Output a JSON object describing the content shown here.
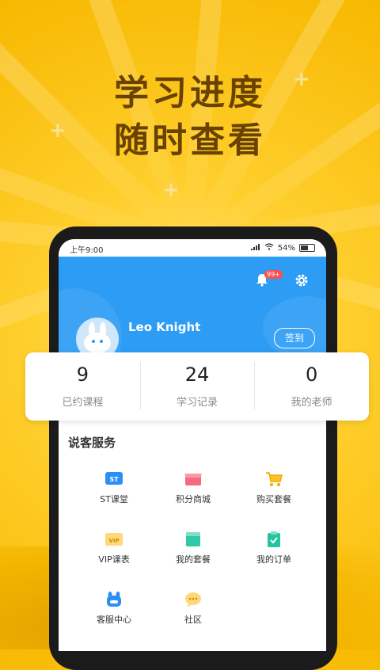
{
  "promo": {
    "headline_line1": "学习进度",
    "headline_line2": "随时查看"
  },
  "status_bar": {
    "time": "上午9:00",
    "battery": "54%"
  },
  "profile": {
    "notifications_badge": "99+",
    "username": "Leo Knight",
    "checkin_label": "签到"
  },
  "stats": [
    {
      "value": "9",
      "label": "已约课程"
    },
    {
      "value": "24",
      "label": "学习记录"
    },
    {
      "value": "0",
      "label": "我的老师"
    }
  ],
  "services": {
    "title": "说客服务",
    "items": [
      {
        "label": "ST课堂",
        "icon": "st-classroom-icon"
      },
      {
        "label": "积分商城",
        "icon": "points-mall-icon"
      },
      {
        "label": "购买套餐",
        "icon": "shopping-cart-icon"
      },
      {
        "label": "VIP课表",
        "icon": "vip-schedule-icon"
      },
      {
        "label": "我的套餐",
        "icon": "my-package-icon"
      },
      {
        "label": "我的订单",
        "icon": "my-orders-icon"
      },
      {
        "label": "客服中心",
        "icon": "customer-service-icon"
      },
      {
        "label": "社区",
        "icon": "community-chat-icon"
      }
    ]
  },
  "colors": {
    "background": "#ffcf2e",
    "headline": "#6a4200",
    "header_blue": "#2c9cf5",
    "badge_red": "#ff4d4f"
  }
}
